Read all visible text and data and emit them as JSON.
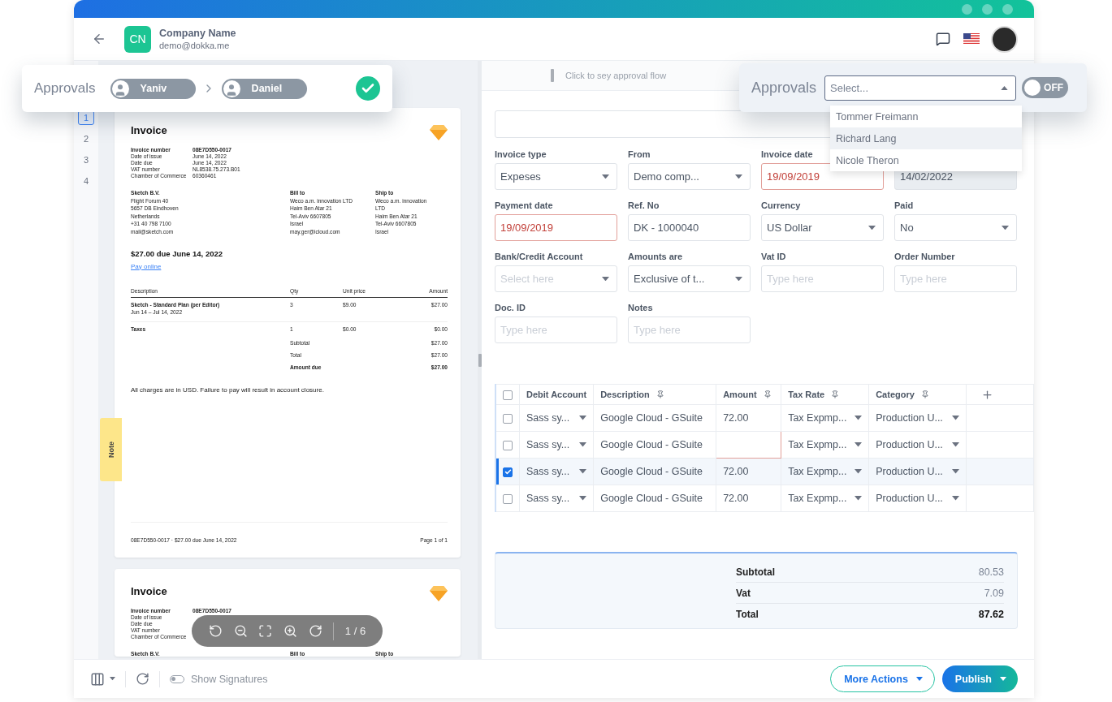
{
  "header": {
    "avatar_initials": "CN",
    "company": "Company Name",
    "email": "demo@dokka.me"
  },
  "approval_flow": {
    "label": "Approvals",
    "approvers": [
      {
        "name": "Yaniv"
      },
      {
        "name": "Daniel"
      }
    ],
    "approved": true
  },
  "flow_hint": "Click to sey approval flow",
  "approval_picker": {
    "label": "Approvals",
    "placeholder": "Select...",
    "expanded": true,
    "toggle": {
      "on": false,
      "label": "OFF"
    },
    "options": [
      {
        "label": "Tommer Freimann",
        "selected": false
      },
      {
        "label": "Richard Lang",
        "selected": true
      },
      {
        "label": "Nicole Theron",
        "selected": false
      }
    ]
  },
  "pages": [
    {
      "label": "1",
      "selected": true
    },
    {
      "label": "2",
      "selected": false
    },
    {
      "label": "3",
      "selected": false
    },
    {
      "label": "4",
      "selected": false
    }
  ],
  "note_tab": "Note",
  "documents": [
    {
      "title": "Invoice",
      "meta": [
        {
          "label": "Invoice number",
          "value": "08E7D550-0017"
        },
        {
          "label": "Date of issue",
          "value": "June 14, 2022"
        },
        {
          "label": "Date due",
          "value": "June 14, 2022"
        },
        {
          "label": "VAT number",
          "value": "NL8538.75.273.B01"
        },
        {
          "label": "Chamber of Commerce",
          "value": "60360461"
        }
      ],
      "from": {
        "heading": "Sketch B.V.",
        "lines": [
          "Flight Forum 40",
          "5657 DB Eindhoven",
          "Netherlands",
          "+31 40 798 7100",
          "mail@sketch.com"
        ]
      },
      "bill_to": {
        "heading": "Bill to",
        "lines": [
          "Weco a.m. innovation LTD",
          "Haim Ben Atar 21",
          "Tel-Aviv 6607805",
          "Israel",
          "may.ger@icloud.com"
        ]
      },
      "ship_to": {
        "heading": "Ship to",
        "lines": [
          "Weco a.m. innovation",
          "LTD",
          "Haim Ben Atar 21",
          "Tel-Aviv 6607805",
          "Israel"
        ]
      },
      "due": "$27.00 due June 14, 2022",
      "pay_link": "Pay online",
      "line_columns": [
        "Description",
        "Qty",
        "Unit price",
        "Amount"
      ],
      "lines": [
        {
          "description": "Sketch - Standard Plan (per Editor)",
          "period": "Jun 14 – Jul 14, 2022",
          "qty": "3",
          "unit": "$9.00",
          "amount": "$27.00"
        },
        {
          "description": "Taxes",
          "qty": "1",
          "unit": "$0.00",
          "amount": "$0.00"
        }
      ],
      "summary": [
        {
          "label": "Subtotal",
          "value": "$27.00"
        },
        {
          "label": "Total",
          "value": "$27.00"
        },
        {
          "label": "Amount due",
          "value": "$27.00"
        }
      ],
      "note": "All charges are in USD. Failure to pay will result in account closure.",
      "footer_left": "08E7D550-0017 · $27.00 due June 14, 2022",
      "footer_right": "Page 1 of 1"
    },
    {
      "title": "Invoice",
      "meta": [
        {
          "label": "Invoice number",
          "value": "08E7D550-0017"
        },
        {
          "label": "Date of issue"
        },
        {
          "label": "Date due"
        },
        {
          "label": "VAT number"
        },
        {
          "label": "Chamber of Commerce"
        }
      ],
      "from": {
        "heading": "Sketch B.V."
      },
      "bill_to": {
        "heading": "Bill to"
      },
      "ship_to": {
        "heading": "Ship to"
      }
    }
  ],
  "viewer_toolbar": {
    "page": "1 / 6"
  },
  "form": {
    "fields": [
      {
        "label": "Invoice type",
        "value": "Expeses",
        "kind": "select",
        "error": false,
        "disabled": false
      },
      {
        "label": "From",
        "value": "Demo comp...",
        "kind": "select",
        "error": false,
        "disabled": false
      },
      {
        "label": "Invoice date",
        "value": "19/09/2019",
        "kind": "text",
        "error": true,
        "disabled": false
      },
      {
        "value": "14/02/2022",
        "kind": "text",
        "error": false,
        "disabled": true
      },
      {
        "label": "Payment date",
        "value": "19/09/2019",
        "kind": "text",
        "error": true,
        "disabled": false
      },
      {
        "label": "Ref. No",
        "value": "DK - 1000040",
        "kind": "text",
        "error": false,
        "disabled": false
      },
      {
        "label": "Currency",
        "value": "US Dollar",
        "kind": "select",
        "error": false,
        "disabled": false
      },
      {
        "label": "Paid",
        "value": "No",
        "kind": "select",
        "error": false,
        "disabled": false
      },
      {
        "label": "Bank/Credit Account",
        "placeholder": "Select here",
        "kind": "select",
        "error": false,
        "disabled": false
      },
      {
        "label": "Amounts are",
        "value": "Exclusive of t...",
        "kind": "select",
        "error": false,
        "disabled": false
      },
      {
        "label": "Vat ID",
        "placeholder": "Type here",
        "kind": "text",
        "error": false,
        "disabled": false
      },
      {
        "label": "Order Number",
        "placeholder": "Type here",
        "kind": "text",
        "error": false,
        "disabled": false
      },
      {
        "label": "Doc. ID",
        "placeholder": "Type here",
        "kind": "text",
        "error": false,
        "disabled": false
      },
      {
        "label": "Notes",
        "placeholder": "Type here",
        "kind": "text",
        "error": false,
        "disabled": false
      }
    ]
  },
  "table": {
    "all_selected": false,
    "columns": [
      {
        "label": "Debit Account",
        "pinned": false,
        "kind": "select"
      },
      {
        "label": "Description",
        "pinned": true,
        "kind": "text"
      },
      {
        "label": "Amount",
        "pinned": true,
        "kind": "text"
      },
      {
        "label": "Tax Rate",
        "pinned": true,
        "kind": "select"
      },
      {
        "label": "Category",
        "pinned": true,
        "kind": "select"
      }
    ],
    "rows": [
      {
        "selected": false,
        "error": false,
        "cells": [
          "Sass sy...",
          "Google Cloud - GSuite",
          "72.00",
          "Tax Expmp...",
          "Production U..."
        ]
      },
      {
        "selected": false,
        "error": true,
        "cells": [
          "Sass sy...",
          "Google Cloud - GSuite",
          "",
          "Tax Expmp...",
          "Production U..."
        ]
      },
      {
        "selected": true,
        "error": false,
        "cells": [
          "Sass sy...",
          "Google Cloud - GSuite",
          "72.00",
          "Tax Expmp...",
          "Production U..."
        ]
      },
      {
        "selected": false,
        "error": false,
        "cells": [
          "Sass sy...",
          "Google Cloud - GSuite",
          "72.00",
          "Tax Expmp...",
          "Production U..."
        ]
      }
    ]
  },
  "totals": [
    {
      "label": "Subtotal",
      "value": "80.53",
      "kind": "sub"
    },
    {
      "label": "Vat",
      "value": "7.09",
      "kind": "sub"
    },
    {
      "label": "Total",
      "value": "87.62",
      "kind": "total"
    }
  ],
  "footer": {
    "signatures": {
      "label": "Show Signatures",
      "on": false
    },
    "buttons": [
      {
        "label": "More Actions",
        "kind": "outline"
      },
      {
        "label": "Publish",
        "kind": "primary"
      }
    ]
  }
}
